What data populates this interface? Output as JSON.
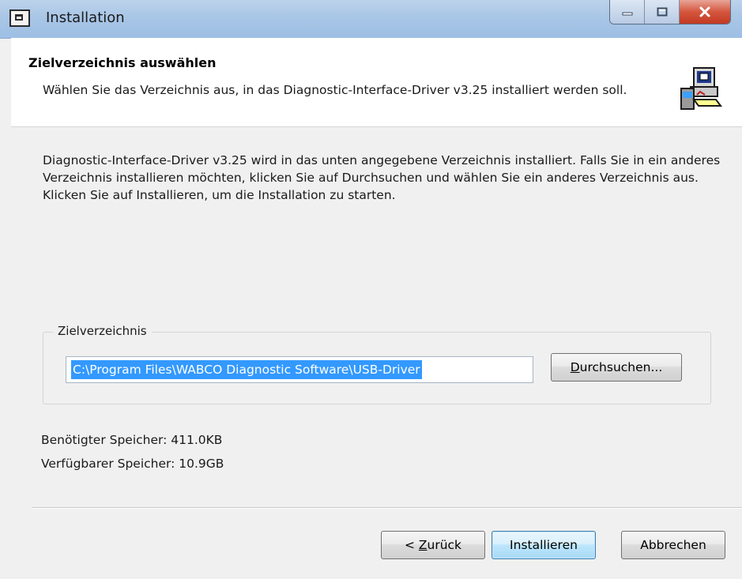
{
  "window": {
    "title": "Installation"
  },
  "header": {
    "title": "Zielverzeichnis auswählen",
    "subtitle": "Wählen Sie das Verzeichnis aus, in das Diagnostic-Interface-Driver v3.25 installiert werden soll."
  },
  "body": {
    "description": "Diagnostic-Interface-Driver v3.25 wird in das unten angegebene Verzeichnis installiert. Falls Sie in ein anderes Verzeichnis installieren möchten, klicken Sie auf Durchsuchen und wählen Sie ein anderes Verzeichnis aus. Klicken Sie auf Installieren, um die Installation zu starten.",
    "group_label": "Zielverzeichnis",
    "path_value": "C:\\Program Files\\WABCO Diagnostic Software\\USB-Driver",
    "browse_label_underlined": "D",
    "browse_label_rest": "urchsuchen...",
    "required_space": "Benötigter Speicher: 411.0KB",
    "available_space": "Verfügbarer Speicher: 10.9GB"
  },
  "buttons": {
    "back_prefix": "< ",
    "back_underlined": "Z",
    "back_rest": "urück",
    "install": "Installieren",
    "cancel": "Abbrechen"
  },
  "icons": {
    "title": "installer-window-icon",
    "header": "installer-computer-icon",
    "minimize": "minimize-icon",
    "maximize": "maximize-icon",
    "close": "close-icon"
  },
  "colors": {
    "selection": "#3399ff",
    "default_button_border": "#3c7fb1",
    "close_button": "#c23a22"
  }
}
